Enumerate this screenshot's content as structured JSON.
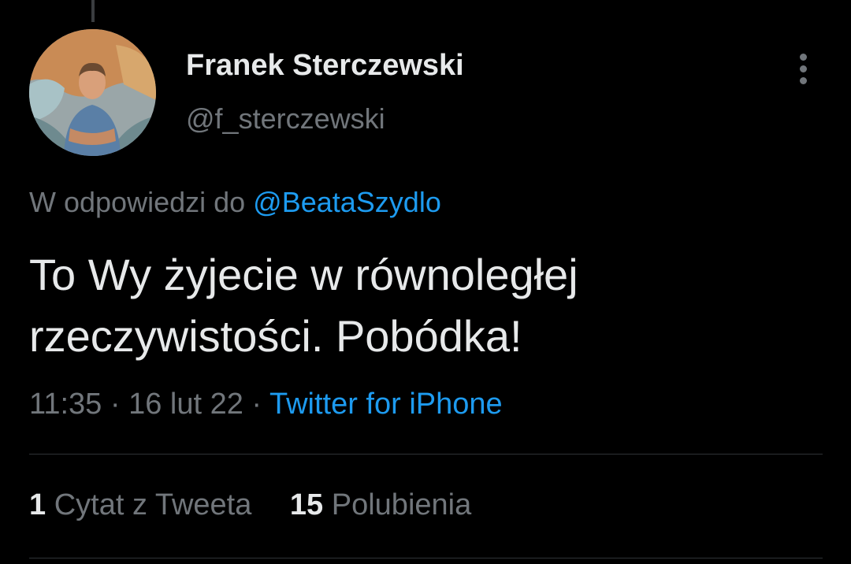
{
  "colors": {
    "background": "#000000",
    "primary_text": "#e7e9ea",
    "secondary_text": "#71767b",
    "link": "#1d9bf0",
    "divider": "#2f3336"
  },
  "author": {
    "display_name": "Franek Sterczewski",
    "handle": "@f_sterczewski",
    "avatar_icon": "profile-photo"
  },
  "more_icon": "more-vertical-icon",
  "reply": {
    "prefix": "W odpowiedzi do",
    "mention": "@BeataSzydlo"
  },
  "tweet": {
    "text": "To Wy żyjecie w równoległej rzeczywistości. Pobódka!"
  },
  "meta": {
    "time": "11:35",
    "separator1": " · ",
    "date": "16 lut 22",
    "separator2": " · ",
    "source": "Twitter for iPhone"
  },
  "stats": {
    "quotes_count": "1",
    "quotes_label": "Cytat z Tweeta",
    "likes_count": "15",
    "likes_label": "Polubienia"
  }
}
